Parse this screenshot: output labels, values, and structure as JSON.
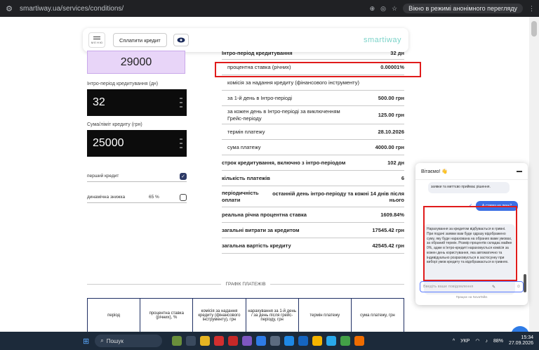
{
  "browser": {
    "url": "smartiway.ua/services/conditions/",
    "incognito": "Вікно в режимі анонімного перегляду"
  },
  "header": {
    "menu_text": "М Е Н Ю",
    "pay_label": "Сплатити кредит",
    "logo": "smartiway"
  },
  "form": {
    "amount": "29000",
    "period_label": "Інтро-період кредитування (дн)",
    "period_value": "32",
    "limit_label": "Сума/ліміт кредиту (грн)",
    "limit_value": "25000",
    "first_credit_label": "перший кредит",
    "dynamic_discount_label": "динамічна знижка",
    "dynamic_discount_value": "65 %"
  },
  "details": [
    {
      "k": "Інтро-період кредитування",
      "v": "32 дн",
      "sub": false
    },
    {
      "k": "процентна ставка (річних)",
      "v": "0.00001%",
      "sub": true
    },
    {
      "k": "комісія за надання кредиту (фінансового інструменту)",
      "v": "",
      "sub": true
    },
    {
      "k": "за 1-й день в Інтро-періоді",
      "v": "500.00 грн",
      "sub": true
    },
    {
      "k": "за кожен день в Інтро-періоді за виключенням Грейс-періоду",
      "v": "125.00 грн",
      "sub": true
    },
    {
      "k": "термін платежу",
      "v": "28.10.2026",
      "sub": true
    },
    {
      "k": "сума платежу",
      "v": "4000.00 грн",
      "sub": true
    },
    {
      "k": "строк кредитування, включно з інтро-періодом",
      "v": "102 дн",
      "sub": false
    },
    {
      "k": "кількість платежів",
      "v": "6",
      "sub": false
    },
    {
      "k": "періодичність оплати",
      "v": "останній день інтро-періоду та кожні 14 днів після нього",
      "sub": false
    },
    {
      "k": "реальна річна процентна ставка",
      "v": "1609.84%",
      "sub": false
    },
    {
      "k": "загальні витрати за кредитом",
      "v": "17545.42 грн",
      "sub": false
    },
    {
      "k": "загальна вартість кредиту",
      "v": "42545.42 грн",
      "sub": false
    }
  ],
  "schedule": {
    "title": "ГРАФІК ПЛАТЕЖІВ",
    "headers": [
      "період",
      "процентна ставка (річних), %",
      "комісія за надання кредиту (фінансового інструменту), грн",
      "нарахування за 1-й день / за день після грейс-періоду, грн",
      "термін платежу",
      "сума платежу, грн"
    ]
  },
  "chat": {
    "title": "Вітаємо! 👋",
    "prev_message": "заявки та миттєво приймає рішення.",
    "user_message": "А ставка на день?",
    "bot_message": "Нарахування за кредитом відбувається в гривні. При подачі заявки вам буде одразу відображено суму, яку буде нарахована на обраних вами умовах, за обраний термін. Розмір процентів складає майже 0%, адже в Інтро-кредиті нараховується комісія за кожен день користування, яка автоматично та індивідуально розраховується в застосунку при виборі умов кредиту та відображається в гривнях.",
    "input_placeholder": "Введіть ваше повідомлення",
    "footer": "Працює на NovaTalks"
  },
  "taskbar": {
    "search": "Пошук",
    "lang": "УКР",
    "battery": "88%",
    "time": "15:34",
    "date": "27.09.2026"
  }
}
